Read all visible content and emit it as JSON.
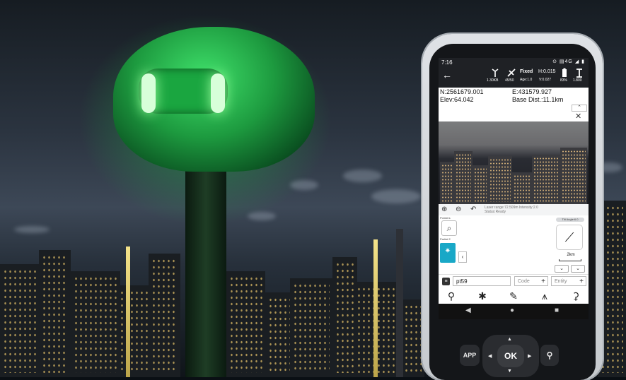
{
  "statusbar": {
    "time": "7:16",
    "system": "⊙ ▤4G ◢ ▮",
    "data_rate": "1.30KB",
    "satellites": "45/50",
    "solution": "Fixed",
    "h_precision": "H:0.015",
    "age": "Age:1.0",
    "v_precision": "V:0.027",
    "battery": "83%",
    "antenna_height": "1.800"
  },
  "coords": {
    "north": "N:2561679.001",
    "east": "E:431579.927",
    "elev": "Elev:64.042",
    "base_dist": "Base Dist.:11.1km"
  },
  "camera": {
    "laser_info": "Laser range:72.509m Intensity:2.0",
    "status": "Status:Ready"
  },
  "side_panel": {
    "label1": "Pointers",
    "label2": "Partial 2",
    "label3": "Laser"
  },
  "tilt": {
    "label": "Tilt Angle:6.0",
    "scale": "2km"
  },
  "entry": {
    "point_name": "pt59",
    "code_placeholder": "Code",
    "entity_placeholder": "Entity"
  },
  "hardware": {
    "app": "APP",
    "ok": "OK"
  },
  "colors": {
    "accent": "#19a8c7",
    "antenna_glow": "#3fe06a"
  }
}
